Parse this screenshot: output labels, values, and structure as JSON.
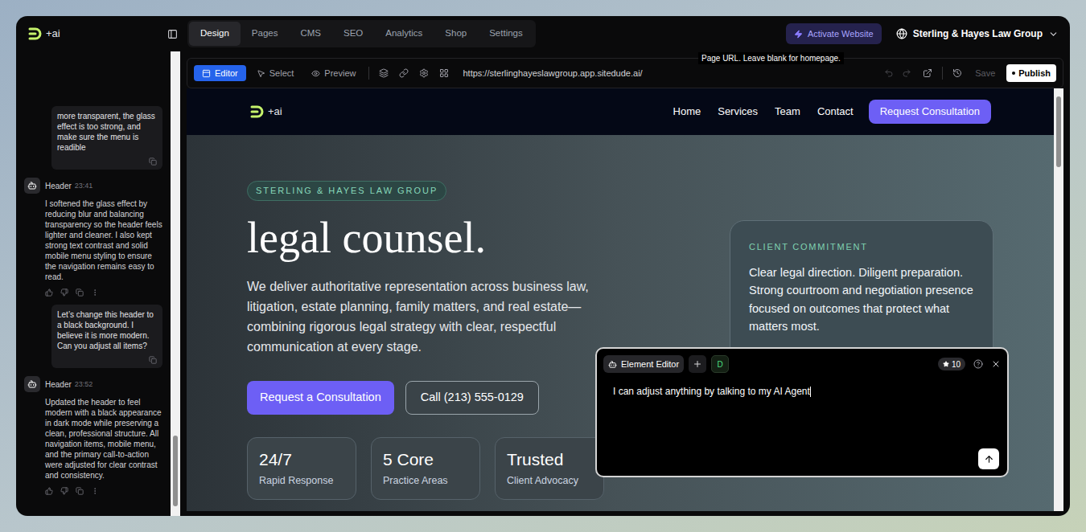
{
  "app": {
    "logo": "+ai"
  },
  "top_tabs": [
    {
      "label": "Design",
      "selected": true
    },
    {
      "label": "Pages",
      "selected": false
    },
    {
      "label": "CMS",
      "selected": false
    },
    {
      "label": "SEO",
      "selected": false
    },
    {
      "label": "Analytics",
      "selected": false
    },
    {
      "label": "Shop",
      "selected": false
    },
    {
      "label": "Settings",
      "selected": false
    }
  ],
  "activate_button": "Activate Website",
  "site_switcher": "Sterling & Hayes Law Group",
  "chat": {
    "messages": [
      {
        "kind": "user",
        "text": "more transparent, the glass effect is too strong, and make sure the menu is readible"
      },
      {
        "kind": "assistant",
        "author": "Header",
        "time": "23:41",
        "text": "I softened the glass effect by reducing blur and balancing transparency so the header feels lighter and cleaner. I also kept strong text contrast and solid mobile menu styling to ensure the navigation remains easy to read."
      },
      {
        "kind": "user",
        "text": "Let’s change this header to a black background. I believe it is more modern. Can you adjust all items?"
      },
      {
        "kind": "assistant",
        "author": "Header",
        "time": "23:52",
        "text": "Updated the header to feel modern with a black appearance in dark mode while preserving a clean, professional structure. All navigation items, mobile menu, and the primary call-to-action were adjusted for clear contrast and consistency."
      }
    ]
  },
  "editor_toolbar": {
    "modes": [
      {
        "label": "Editor",
        "selected": true
      },
      {
        "label": "Select",
        "selected": false
      },
      {
        "label": "Preview",
        "selected": false
      }
    ],
    "url": "https://sterlinghayeslawgroup.app.sitedude.ai/",
    "url_tooltip": "Page URL. Leave blank for homepage.",
    "undo_disabled": true,
    "redo_disabled": true,
    "save": {
      "label": "Save",
      "disabled": true
    },
    "publish": "Publish"
  },
  "preview": {
    "nav": {
      "logo": "+ai",
      "links": [
        "Home",
        "Services",
        "Team",
        "Contact"
      ],
      "cta": "Request Consultation"
    },
    "hero": {
      "badge": "STERLING & HAYES LAW GROUP",
      "heading": "legal counsel.",
      "paragraph": "We deliver authoritative representation across business law, litigation, estate planning, family matters, and real estate—combining rigorous legal strategy with clear, respectful communication at every stage.",
      "primary_button": "Request a Consultation",
      "secondary_button": "Call (213) 555-0129",
      "stats": [
        {
          "value": "24/7",
          "label": "Rapid Response"
        },
        {
          "value": "5 Core",
          "label": "Practice Areas"
        },
        {
          "value": "Trusted",
          "label": "Client Advocacy"
        }
      ],
      "card": {
        "title": "CLIENT COMMITMENT",
        "text": "Clear legal direction. Diligent preparation. Strong courtroom and negotiation presence focused on outcomes that protect what matters most."
      }
    }
  },
  "element_editor": {
    "title": "Element Editor",
    "chip": "D",
    "credits": "10",
    "input": "I can adjust anything by talking to my AI Agent"
  }
}
